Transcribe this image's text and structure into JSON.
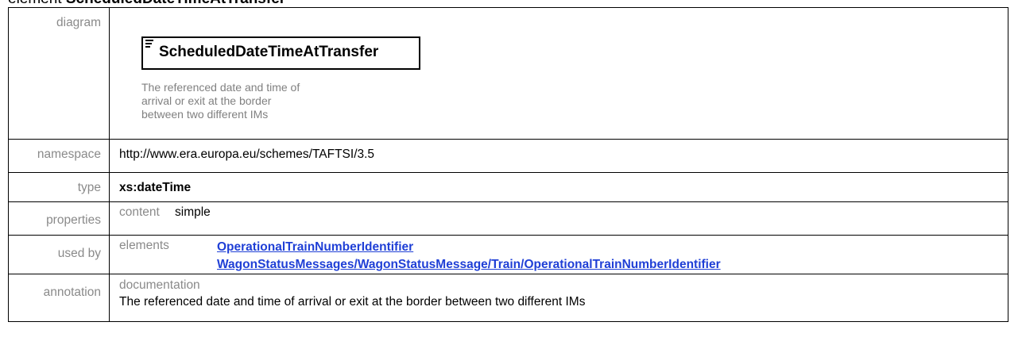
{
  "heading": {
    "prefix": "element ",
    "name": "ScheduledDateTimeAtTransfer"
  },
  "rows": {
    "diagram": {
      "label": "diagram",
      "element_name": "ScheduledDateTimeAtTransfer",
      "doc": "The referenced date and time of arrival or exit at the border between two different IMs"
    },
    "namespace": {
      "label": "namespace",
      "value": "http://www.era.europa.eu/schemes/TAFTSI/3.5"
    },
    "type": {
      "label": "type",
      "value": "xs:dateTime"
    },
    "properties": {
      "label": "properties",
      "key": "content",
      "value": "simple"
    },
    "used_by": {
      "label": "used by",
      "key": "elements",
      "links": [
        "OperationalTrainNumberIdentifier",
        "WagonStatusMessages/WagonStatusMessage/Train/OperationalTrainNumberIdentifier"
      ]
    },
    "annotation": {
      "label": "annotation",
      "title": "documentation",
      "text": "The referenced date and time of arrival or exit at the border between two different IMs"
    }
  },
  "colors": {
    "label": "#8a8a8a",
    "link": "#1f3fd6",
    "border": "#000000"
  }
}
